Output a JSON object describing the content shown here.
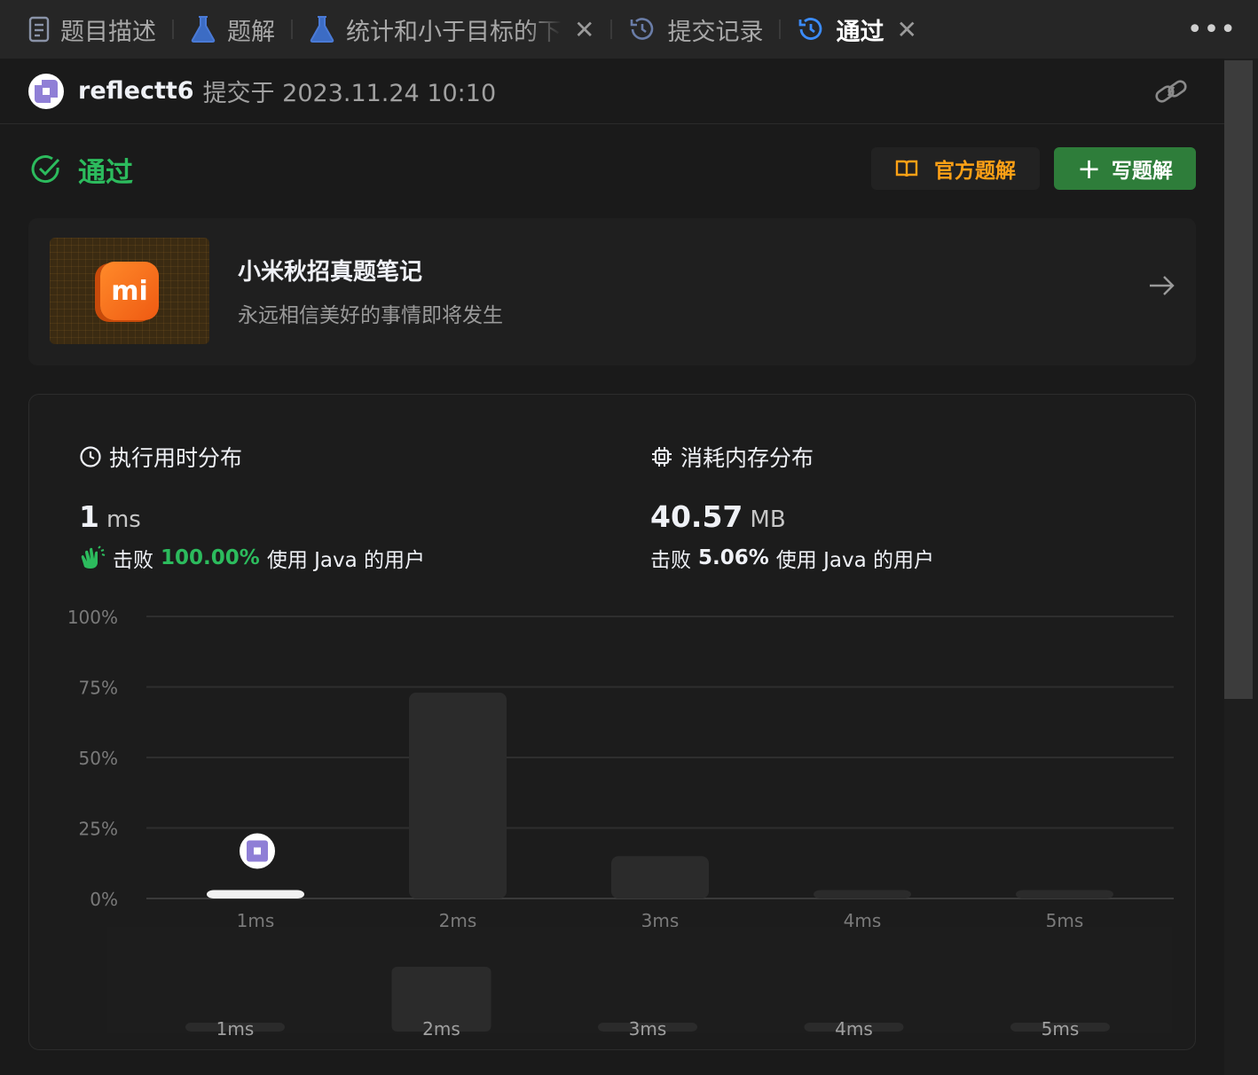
{
  "tabs": [
    {
      "label": "题目描述",
      "icon": "document-icon",
      "active": false
    },
    {
      "label": "题解",
      "icon": "flask-icon",
      "active": false
    },
    {
      "label": "统计和小于目标的下",
      "icon": "flask-icon",
      "active": false,
      "closable": true
    },
    {
      "label": "提交记录",
      "icon": "history-icon",
      "active": false
    },
    {
      "label": "通过",
      "icon": "history-icon",
      "active": true,
      "closable": true
    }
  ],
  "more_label": "•••",
  "submission": {
    "username": "reflectt6",
    "submitted_at": "提交于 2023.11.24 10:10"
  },
  "status": {
    "label": "通过",
    "official_solution_label": "官方题解",
    "write_solution_label": "写题解",
    "colors": {
      "accepted": "#2cbb5d",
      "official": "#ffa116",
      "write_bg": "#2e7d3a"
    }
  },
  "promo": {
    "title": "小米秋招真题笔记",
    "subtitle": "永远相信美好的事情即将发生",
    "logo_text": "mi"
  },
  "runtime": {
    "title": "执行用时分布",
    "value": "1",
    "unit": "ms",
    "beat_prefix": "击败",
    "beat_pct": "100.00%",
    "beat_suffix": "使用 Java 的用户"
  },
  "memory": {
    "title": "消耗内存分布",
    "value": "40.57",
    "unit": "MB",
    "beat_prefix": "击败",
    "beat_pct": "5.06%",
    "beat_suffix": "使用 Java 的用户"
  },
  "chart_data": {
    "type": "bar",
    "categories": [
      "1ms",
      "2ms",
      "3ms",
      "4ms",
      "5ms"
    ],
    "values": [
      3,
      73,
      15,
      3,
      3
    ],
    "ylim": [
      0,
      100
    ],
    "yticks": [
      "100%",
      "75%",
      "50%",
      "25%",
      "0%"
    ],
    "highlight_category": "1ms",
    "grid": true,
    "mini_overview": {
      "categories": [
        "1ms",
        "2ms",
        "3ms",
        "4ms",
        "5ms"
      ],
      "values": [
        3,
        73,
        3,
        3,
        3
      ]
    }
  }
}
